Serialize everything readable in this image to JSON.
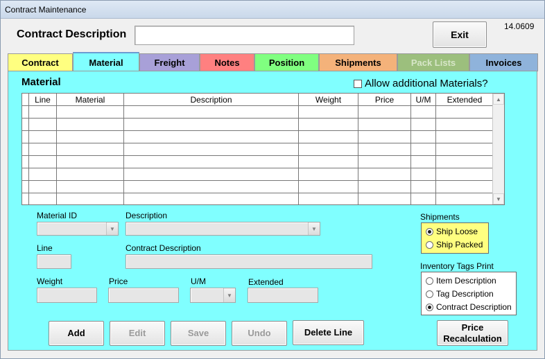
{
  "window": {
    "title": "Contract Maintenance",
    "version": "14.0609"
  },
  "header": {
    "contract_description_label": "Contract Description",
    "contract_description_value": "",
    "exit_label": "Exit"
  },
  "tabs": [
    {
      "label": "Contract",
      "color": "#ffff80",
      "active": false,
      "disabled": false
    },
    {
      "label": "Material",
      "color": "#80ffff",
      "active": true,
      "disabled": false
    },
    {
      "label": "Freight",
      "color": "#a8a0d8",
      "active": false,
      "disabled": false
    },
    {
      "label": "Notes",
      "color": "#ff8080",
      "active": false,
      "disabled": false
    },
    {
      "label": "Position",
      "color": "#80ff80",
      "active": false,
      "disabled": false
    },
    {
      "label": "Shipments",
      "color": "#f4b27a",
      "active": false,
      "disabled": false
    },
    {
      "label": "Pack Lists",
      "color": "#9cbf7d",
      "active": false,
      "disabled": true
    },
    {
      "label": "Invoices",
      "color": "#8fb3db",
      "active": false,
      "disabled": false
    }
  ],
  "material": {
    "section_title": "Material",
    "allow_additional_label": "Allow additional Materials?",
    "allow_additional_checked": false,
    "grid": {
      "columns": [
        "Line",
        "Material",
        "Description",
        "Weight",
        "Price",
        "U/M",
        "Extended"
      ],
      "rows": [
        [
          "",
          "",
          "",
          "",
          "",
          "",
          ""
        ],
        [
          "",
          "",
          "",
          "",
          "",
          "",
          ""
        ],
        [
          "",
          "",
          "",
          "",
          "",
          "",
          ""
        ],
        [
          "",
          "",
          "",
          "",
          "",
          "",
          ""
        ],
        [
          "",
          "",
          "",
          "",
          "",
          "",
          ""
        ],
        [
          "",
          "",
          "",
          "",
          "",
          "",
          ""
        ],
        [
          "",
          "",
          "",
          "",
          "",
          "",
          ""
        ],
        [
          "",
          "",
          "",
          "",
          "",
          "",
          ""
        ]
      ]
    }
  },
  "form": {
    "material_id_label": "Material ID",
    "description_label": "Description",
    "line_label": "Line",
    "contract_description_label": "Contract Description",
    "weight_label": "Weight",
    "price_label": "Price",
    "um_label": "U/M",
    "extended_label": "Extended"
  },
  "shipments": {
    "label": "Shipments",
    "options": [
      {
        "label": "Ship Loose",
        "checked": true
      },
      {
        "label": "Ship Packed",
        "checked": false
      }
    ]
  },
  "inventory_tags": {
    "label": "Inventory Tags Print",
    "options": [
      {
        "label": "Item Description",
        "checked": false
      },
      {
        "label": "Tag Description",
        "checked": false
      },
      {
        "label": "Contract Description",
        "checked": true
      }
    ]
  },
  "buttons": {
    "add": "Add",
    "edit": "Edit",
    "save": "Save",
    "undo": "Undo",
    "delete_line": "Delete Line",
    "price_recalc_line1": "Price",
    "price_recalc_line2": "Recalculation"
  }
}
